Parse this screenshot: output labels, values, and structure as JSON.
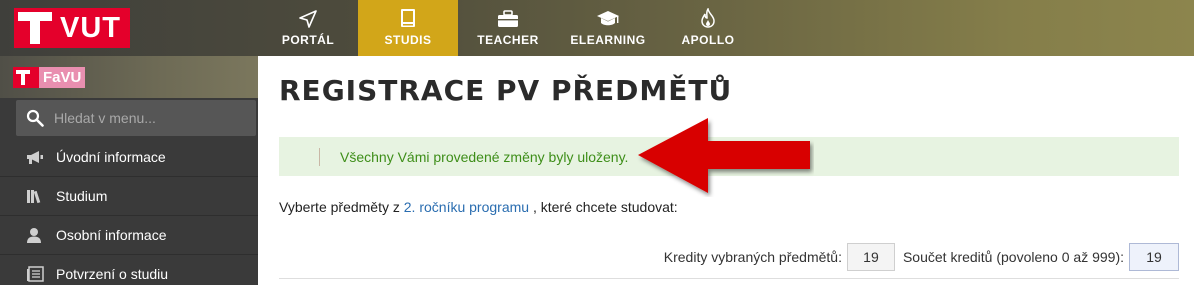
{
  "brand": {
    "university": "VUT",
    "faculty": "FaVU",
    "brand_color": "#e4002b",
    "faculty_color": "#e98fb0"
  },
  "nav": {
    "accent": "#d2a619",
    "items": [
      {
        "label": "PORTÁL",
        "icon": "send-icon",
        "active": false
      },
      {
        "label": "STUDIS",
        "icon": "book-icon",
        "active": true
      },
      {
        "label": "TEACHER",
        "icon": "briefcase-icon",
        "active": false
      },
      {
        "label": "ELEARNING",
        "icon": "graduation-cap-icon",
        "active": false
      },
      {
        "label": "APOLLO",
        "icon": "flame-icon",
        "active": false
      }
    ]
  },
  "sidebar": {
    "search_placeholder": "Hledat v menu...",
    "items": [
      {
        "label": "Úvodní informace",
        "icon": "megaphone-icon"
      },
      {
        "label": "Studium",
        "icon": "books-icon"
      },
      {
        "label": "Osobní informace",
        "icon": "user-icon"
      },
      {
        "label": "Potvrzení o studiu",
        "icon": "document-icon"
      }
    ]
  },
  "main": {
    "title": "REGISTRACE PV PŘEDMĚTŮ",
    "alert": {
      "message": "Všechny Vámi provedené změny byly uloženy.",
      "color": "#3e8e19"
    },
    "intro": {
      "before": "Vyberte předměty z ",
      "link": "2. ročníku programu",
      "after": " , které chcete studovat:"
    },
    "credits": {
      "selected_label": "Kredity vybraných předmětů:",
      "selected_value": "19",
      "total_label": "Součet kreditů (povoleno 0 až 999):",
      "total_value": "19"
    }
  }
}
